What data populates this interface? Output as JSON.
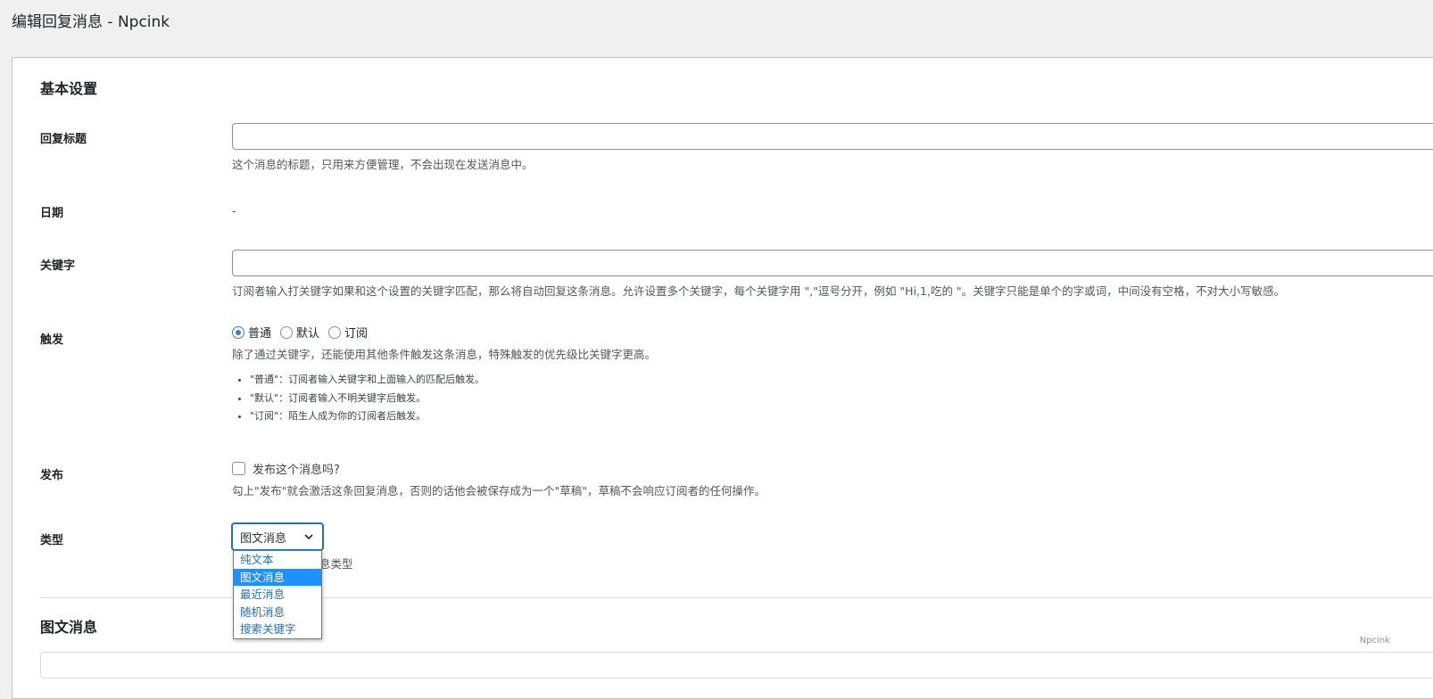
{
  "page": {
    "title": "编辑回复消息 - Npcink"
  },
  "basic": {
    "section_title": "基本设置",
    "reply_title": {
      "label": "回复标题",
      "value": "",
      "description": "这个消息的标题，只用来方便管理，不会出现在发送消息中。"
    },
    "date": {
      "label": "日期",
      "value": "-"
    },
    "keyword": {
      "label": "关键字",
      "value": "",
      "description": "订阅者输入打关键字如果和这个设置的关键字匹配，那么将自动回复这条消息。允许设置多个关键字，每个关键字用 \",\"逗号分开，例如 \"Hi,1,吃的 \"。关键字只能是单个的字或词，中间没有空格，不对大小写敏感。"
    },
    "trigger": {
      "label": "触发",
      "options": [
        "普通",
        "默认",
        "订阅"
      ],
      "selected": "普通",
      "description": "除了通过关键字，还能使用其他条件触发这条消息，特殊触发的优先级比关键字更高。",
      "notes": [
        "\"普通\"：订阅者输入关键字和上面输入的匹配后触发。",
        "\"默认\"：订阅者输入不明关键字后触发。",
        "\"订阅\"：陌生人成为你的订阅者后触发。"
      ]
    },
    "publish": {
      "label": "发布",
      "checkbox_label": "发布这个消息吗?",
      "checked": false,
      "description": "勾上\"发布\"就会激活这条回复消息，否则的话他会被保存成为一个\"草稿\"，草稿不会响应订阅者的任何操作。"
    },
    "type": {
      "label": "类型",
      "selected": "图文消息",
      "description_visible": "息类型",
      "options": [
        "纯文本",
        "图文消息",
        "最近消息",
        "随机消息",
        "搜索关键字"
      ]
    }
  },
  "news": {
    "section_title": "图文消息"
  },
  "watermark": "Npcink",
  "colors": {
    "accent": "#2271b1",
    "highlight": "#1e90ff",
    "background": "#f0f0f1"
  }
}
